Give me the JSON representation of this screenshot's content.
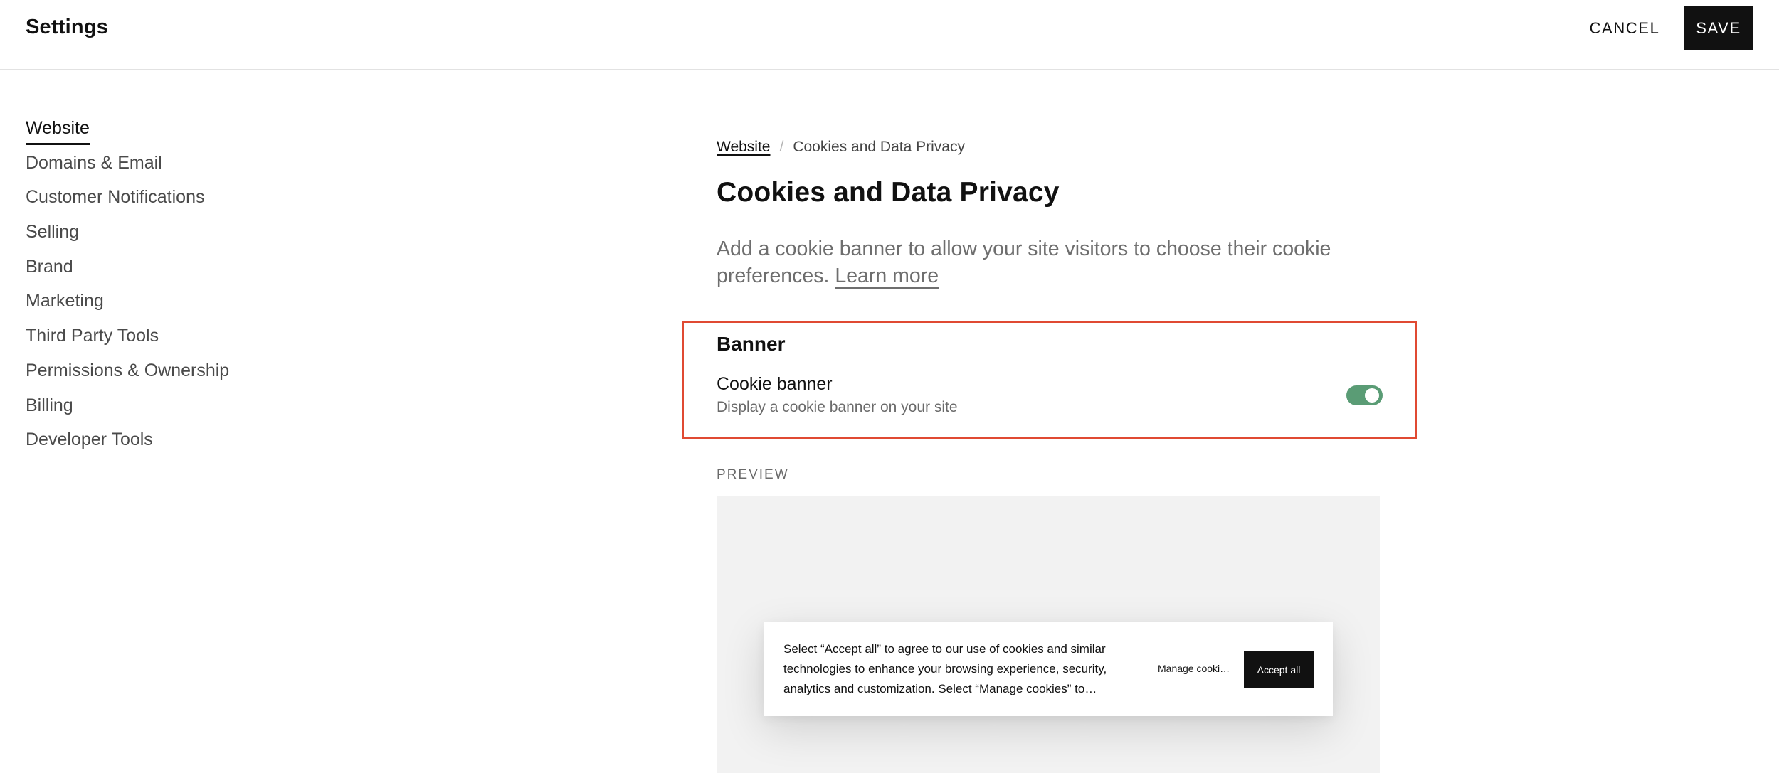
{
  "header": {
    "title": "Settings",
    "cancel_label": "CANCEL",
    "save_label": "SAVE"
  },
  "sidebar": {
    "items": [
      {
        "label": "Website",
        "active": true
      },
      {
        "label": "Domains & Email",
        "active": false
      },
      {
        "label": "Customer Notifications",
        "active": false
      },
      {
        "label": "Selling",
        "active": false
      },
      {
        "label": "Brand",
        "active": false
      },
      {
        "label": "Marketing",
        "active": false
      },
      {
        "label": "Third Party Tools",
        "active": false
      },
      {
        "label": "Permissions & Ownership",
        "active": false
      },
      {
        "label": "Billing",
        "active": false
      },
      {
        "label": "Developer Tools",
        "active": false
      }
    ]
  },
  "main": {
    "breadcrumb": {
      "parent": "Website",
      "separator": "/",
      "current": "Cookies and Data Privacy"
    },
    "title": "Cookies and Data Privacy",
    "description": "Add a cookie banner to allow your site visitors to choose their cookie preferences.",
    "learn_more": "Learn more",
    "banner_section": {
      "heading": "Banner",
      "cookie_banner_label": "Cookie banner",
      "cookie_banner_sub": "Display a cookie banner on your site",
      "toggle_on": true
    },
    "preview": {
      "label": "PREVIEW",
      "cookie_text": "Select “Accept all” to agree to our use of cookies and similar technologies to enhance your browsing experience, security, analytics and customization. Select “Manage cookies” to…",
      "manage_label": "Manage cooki…",
      "accept_label": "Accept all"
    }
  },
  "colors": {
    "accent_dark": "#111111",
    "toggle_on": "#5a9c75",
    "highlight_border": "#e04a32",
    "muted_text": "#6e6e6e"
  }
}
